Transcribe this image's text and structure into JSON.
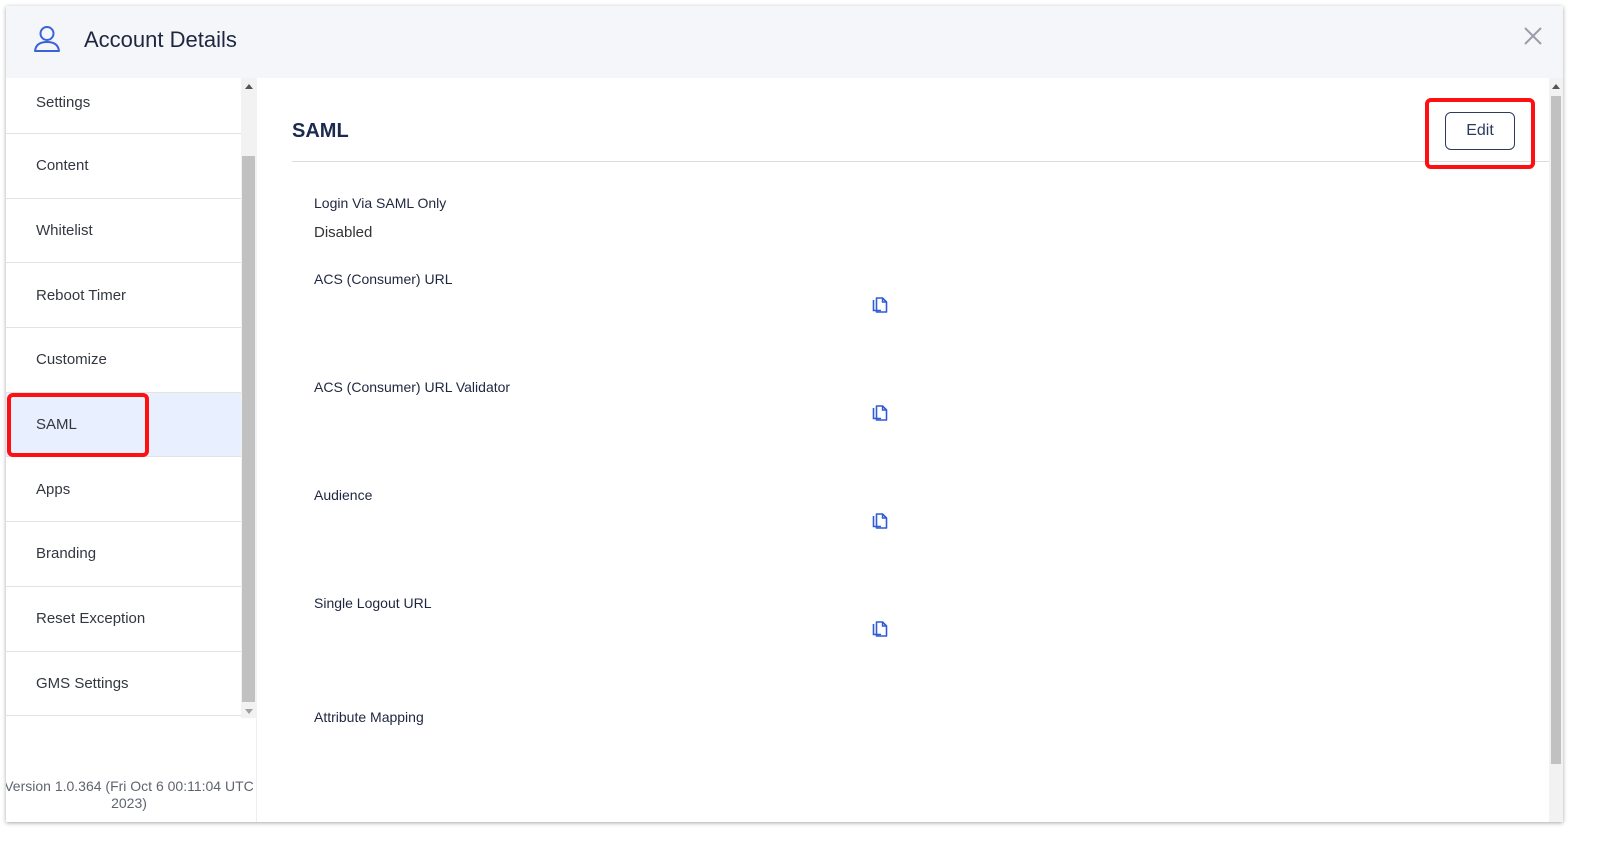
{
  "header": {
    "title": "Account Details",
    "icon": "user-icon",
    "close_icon": "close-icon"
  },
  "sidebar": {
    "items": [
      {
        "label": "Settings"
      },
      {
        "label": "Content"
      },
      {
        "label": "Whitelist"
      },
      {
        "label": "Reboot Timer"
      },
      {
        "label": "Customize"
      },
      {
        "label": "SAML",
        "active": true
      },
      {
        "label": "Apps"
      },
      {
        "label": "Branding"
      },
      {
        "label": "Reset Exception"
      },
      {
        "label": "GMS Settings"
      }
    ],
    "version": "Version 1.0.364 (Fri Oct 6 00:11:04 UTC 2023)"
  },
  "main": {
    "title": "SAML",
    "edit_label": "Edit",
    "fields": {
      "login_saml_only": {
        "label": "Login Via SAML Only",
        "value": "Disabled"
      },
      "acs_url": {
        "label": "ACS (Consumer) URL"
      },
      "acs_validator": {
        "label": "ACS (Consumer) URL Validator"
      },
      "audience": {
        "label": "Audience"
      },
      "single_logout": {
        "label": "Single Logout URL"
      },
      "attribute_mapping": {
        "label": "Attribute Mapping"
      }
    }
  },
  "colors": {
    "highlight": "#ff1010",
    "active_bg": "#e8efff",
    "accent": "#2f5bd6"
  }
}
